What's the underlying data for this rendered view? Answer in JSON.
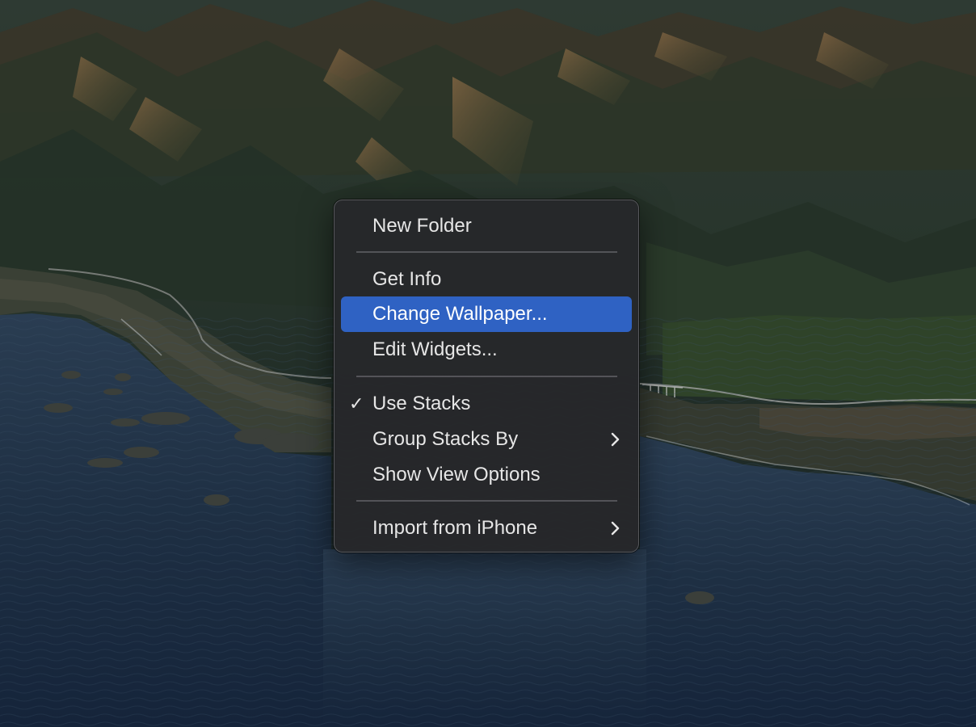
{
  "menu": {
    "items": [
      {
        "label": "New Folder"
      },
      {
        "label": "Get Info"
      },
      {
        "label": "Change Wallpaper..."
      },
      {
        "label": "Edit Widgets..."
      },
      {
        "label": "Use Stacks",
        "check": "✓"
      },
      {
        "label": "Group Stacks By"
      },
      {
        "label": "Show View Options"
      },
      {
        "label": "Import from iPhone"
      }
    ],
    "highlighted_item": "Change Wallpaper...",
    "checked_item": "Use Stacks",
    "submenu_indicator_icon": "chevron-right-icon"
  },
  "colors": {
    "menu_background": "#26282b",
    "highlight": "#2f62c3",
    "menu_text": "#e6e6e6"
  }
}
